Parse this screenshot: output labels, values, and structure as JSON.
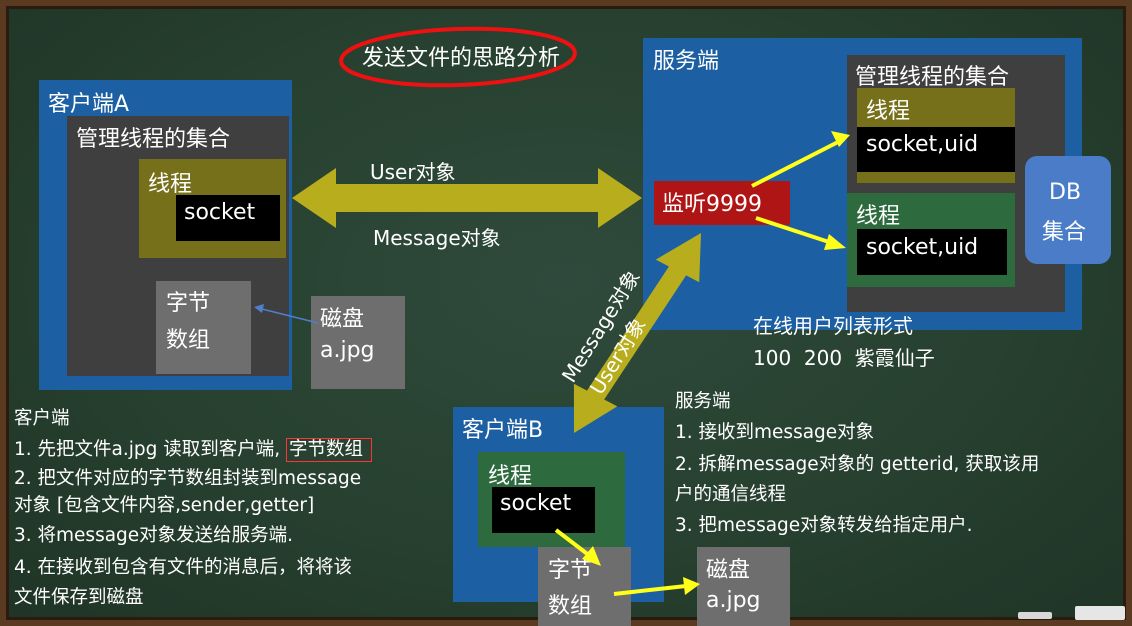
{
  "title": "发送文件的思路分析",
  "client_a": {
    "label": "客户端A",
    "manage": "管理线程的集合",
    "thread": "线程",
    "socket": "socket",
    "bytes_line1": "字节",
    "bytes_line2": "数组",
    "disk_line1": "磁盘",
    "disk_line2": "a.jpg"
  },
  "arrow_labels": {
    "user": "User对象",
    "message": "Message对象",
    "diag_message": "Message对象",
    "diag_user": "User对象"
  },
  "server": {
    "label": "服务端",
    "manage": "管理线程的集合",
    "listen": "监听9999",
    "thread1": "线程",
    "socket1": "socket,uid",
    "thread2": "线程",
    "socket2": "socket,uid",
    "db_line1": "DB",
    "db_line2": "集合",
    "online_title": "在线用户列表形式",
    "online_values": "100  200  紫霞仙子"
  },
  "client_b": {
    "label": "客户端B",
    "thread": "线程",
    "socket": "socket",
    "bytes_line1": "字节",
    "bytes_line2": "数组",
    "disk_line1": "磁盘",
    "disk_line2": "a.jpg"
  },
  "notes_client": {
    "heading": "客户端",
    "l1_prefix": "1. 先把文件a.jpg 读取到客户端, ",
    "l1_highlight": "字节数组",
    "l2": "2. 把文件对应的字节数组封装到message",
    "l3": "对象 [包含文件内容,sender,getter]",
    "l4": "3. 将message对象发送给服务端.",
    "l5": "4. 在接收到包含有文件的消息后，将将该",
    "l6": "文件保存到磁盘"
  },
  "notes_server": {
    "heading": "服务端",
    "l1": "1. 接收到message对象",
    "l2": "2. 拆解message对象的 getterid, 获取该用",
    "l3": "户的通信线程",
    "l4": "3. 把message对象转发给指定用户."
  },
  "colors": {
    "board": "#27402f",
    "frame": "#5a3b22",
    "blue_box": "#1c5fa2",
    "dark_box": "#3f3f3f",
    "olive_thread": "#76701b",
    "green_thread": "#2d6b3f",
    "listen_red": "#b01515",
    "db_blue": "#4a7cc7",
    "arrow_olive": "#b7ad1d",
    "arrow_yellow": "#ffff1a",
    "title_circle": "#ee1111",
    "highlight_border": "#ff3333",
    "small_arrow": "#4f7fc8"
  }
}
